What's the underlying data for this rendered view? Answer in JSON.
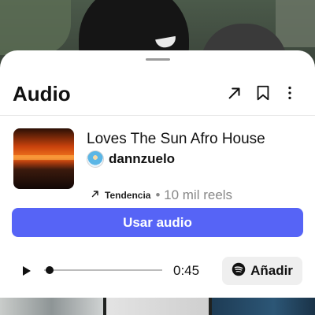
{
  "sheet": {
    "title": "Audio",
    "header_icons": [
      "share-arrow-icon",
      "bookmark-icon",
      "more-options-icon"
    ]
  },
  "track": {
    "title": "Loves The Sun Afro House",
    "artist": "dannzuelo",
    "trend_label": "Tendencia",
    "reels_count": "• 10 mil reels"
  },
  "actions": {
    "use_audio": "Usar audio",
    "add": "Añadir"
  },
  "player": {
    "time": "0:45",
    "progress": 0.0
  },
  "colors": {
    "primary_button": "#5664f6",
    "secondary_button": "#efefef"
  }
}
